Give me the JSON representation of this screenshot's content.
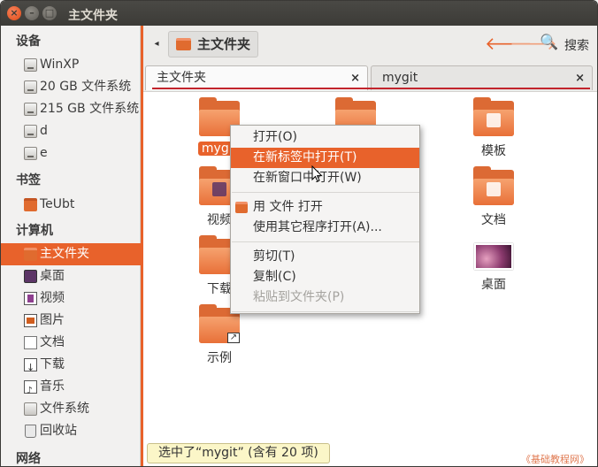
{
  "window": {
    "title": "主文件夹",
    "close_glyph": "×",
    "min_glyph": "–",
    "max_glyph": "□"
  },
  "sidebar": {
    "groups": [
      {
        "label": "设备",
        "items": [
          {
            "label": "WinXP",
            "icon": "drive-icon"
          },
          {
            "label": "20 GB 文件系统",
            "icon": "drive-icon"
          },
          {
            "label": "215 GB 文件系统",
            "icon": "drive-icon"
          },
          {
            "label": "d",
            "icon": "drive-icon"
          },
          {
            "label": "e",
            "icon": "drive-icon"
          }
        ]
      },
      {
        "label": "书签",
        "items": [
          {
            "label": "TeUbt",
            "icon": "folder-icon"
          }
        ]
      },
      {
        "label": "计算机",
        "items": [
          {
            "label": "主文件夹",
            "icon": "home-folder-icon",
            "active": true
          },
          {
            "label": "桌面",
            "icon": "desktop-icon"
          },
          {
            "label": "视频",
            "icon": "video-icon"
          },
          {
            "label": "图片",
            "icon": "picture-icon"
          },
          {
            "label": "文档",
            "icon": "document-icon"
          },
          {
            "label": "下载",
            "icon": "download-icon"
          },
          {
            "label": "音乐",
            "icon": "music-icon"
          },
          {
            "label": "文件系统",
            "icon": "filesystem-icon"
          },
          {
            "label": "回收站",
            "icon": "trash-icon"
          }
        ]
      },
      {
        "label": "网络",
        "items": []
      }
    ]
  },
  "toolbar": {
    "back_glyph": "◂",
    "location": "主文件夹",
    "back_arrow": "🡐",
    "forward_arrow": "🡒",
    "search_glyph": "🔍",
    "search_label": "搜索"
  },
  "tabs": [
    {
      "label": "主文件夹",
      "close": "×",
      "active": true
    },
    {
      "label": "mygit",
      "close": "×",
      "active": false
    }
  ],
  "files": [
    {
      "label": "mygit",
      "icon": "folder-icon",
      "selected": true
    },
    {
      "label": "",
      "icon": "public-folder-icon"
    },
    {
      "label": "模板",
      "icon": "templates-folder-icon"
    },
    {
      "label": "视频",
      "icon": "video-folder-icon"
    },
    {
      "label": "文档",
      "icon": "documents-folder-icon"
    },
    {
      "label": "下载",
      "icon": "download-folder-icon"
    },
    {
      "label": "桌面",
      "icon": "desktop-thumbnail"
    },
    {
      "label": "示例",
      "icon": "examples-link-folder-icon"
    }
  ],
  "context_menu": {
    "items": [
      {
        "label": "打开(O)",
        "state": "normal"
      },
      {
        "label": "在新标签中打开(T)",
        "state": "highlighted"
      },
      {
        "label": "在新窗口中打开(W)",
        "state": "normal"
      },
      {
        "label": "用 文件 打开",
        "state": "normal",
        "icon": "files-app-icon"
      },
      {
        "label": "使用其它程序打开(A)...",
        "state": "normal"
      },
      {
        "label": "剪切(T)",
        "state": "normal"
      },
      {
        "label": "复制(C)",
        "state": "normal"
      },
      {
        "label": "粘贴到文件夹(P)",
        "state": "disabled"
      }
    ]
  },
  "status_bar": {
    "text": "选中了“mygit” (含有 20 项)"
  },
  "watermark": "《基础教程网》",
  "colors": {
    "accent": "#e8622b",
    "tab_underline": "#c2242c",
    "titlebar": "#3c3b37",
    "status_bg": "#fbf6c8"
  }
}
